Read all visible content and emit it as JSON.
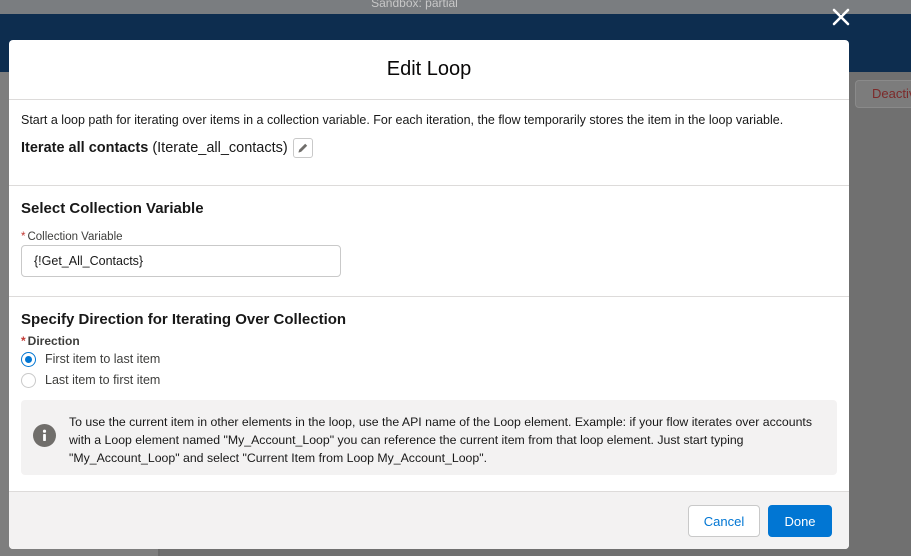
{
  "background": {
    "sandbox_label": "Sandbox: partial",
    "deactivate_label": "Deactiv"
  },
  "modal": {
    "title": "Edit Loop",
    "description": "Start a loop path for iterating over items in a collection variable. For each iteration, the flow temporarily stores the item in the loop variable.",
    "element_label": "Iterate all contacts",
    "element_api_name": "(Iterate_all_contacts)",
    "collection_section": {
      "heading": "Select Collection Variable",
      "field_label": "Collection Variable",
      "field_value": "{!Get_All_Contacts}"
    },
    "direction_section": {
      "heading": "Specify Direction for Iterating Over Collection",
      "field_label": "Direction",
      "options": [
        {
          "label": "First item to last item",
          "checked": true
        },
        {
          "label": "Last item to first item",
          "checked": false
        }
      ]
    },
    "info_text": "To use the current item in other elements in the loop, use the API name of the Loop element. Example: if your flow iterates over accounts with a Loop element named \"My_Account_Loop\" you can reference the current item from that loop element. Just start typing \"My_Account_Loop\" and select \"Current Item from Loop My_Account_Loop\".",
    "footer": {
      "cancel_label": "Cancel",
      "done_label": "Done"
    }
  },
  "icons": {
    "close": "close-icon",
    "edit": "pencil-icon",
    "info": "info-icon"
  },
  "colors": {
    "brand": "#0176d3",
    "header_bg": "#0d2d4f",
    "required": "#c23934"
  }
}
